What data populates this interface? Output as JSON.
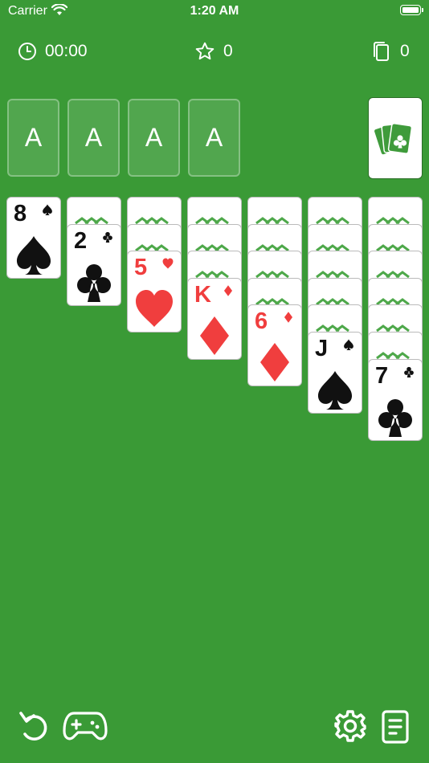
{
  "status": {
    "carrier": "Carrier",
    "time": "1:20 AM"
  },
  "stats": {
    "timer": "00:00",
    "score": "0",
    "moves": "0"
  },
  "foundations": [
    "A",
    "A",
    "A",
    "A"
  ],
  "tableau": [
    {
      "hidden": 0,
      "card": {
        "rank": "8",
        "suit": "spade",
        "color": "black"
      }
    },
    {
      "hidden": 1,
      "card": {
        "rank": "2",
        "suit": "club",
        "color": "black"
      }
    },
    {
      "hidden": 2,
      "card": {
        "rank": "5",
        "suit": "heart",
        "color": "red"
      }
    },
    {
      "hidden": 3,
      "card": {
        "rank": "K",
        "suit": "diamond",
        "color": "red"
      }
    },
    {
      "hidden": 4,
      "card": {
        "rank": "6",
        "suit": "diamond",
        "color": "red"
      }
    },
    {
      "hidden": 5,
      "card": {
        "rank": "J",
        "suit": "spade",
        "color": "black"
      }
    },
    {
      "hidden": 6,
      "card": {
        "rank": "7",
        "suit": "club",
        "color": "black"
      }
    }
  ],
  "colors": {
    "felt": "#3a9a36",
    "red_suit": "#f03e3e",
    "black_suit": "#111111"
  },
  "icons": {
    "timer": "clock-icon",
    "score": "star-icon",
    "moves": "cards-copy-icon",
    "undo": "undo-icon",
    "game": "gamepad-icon",
    "settings": "gear-icon",
    "rules": "document-icon"
  }
}
